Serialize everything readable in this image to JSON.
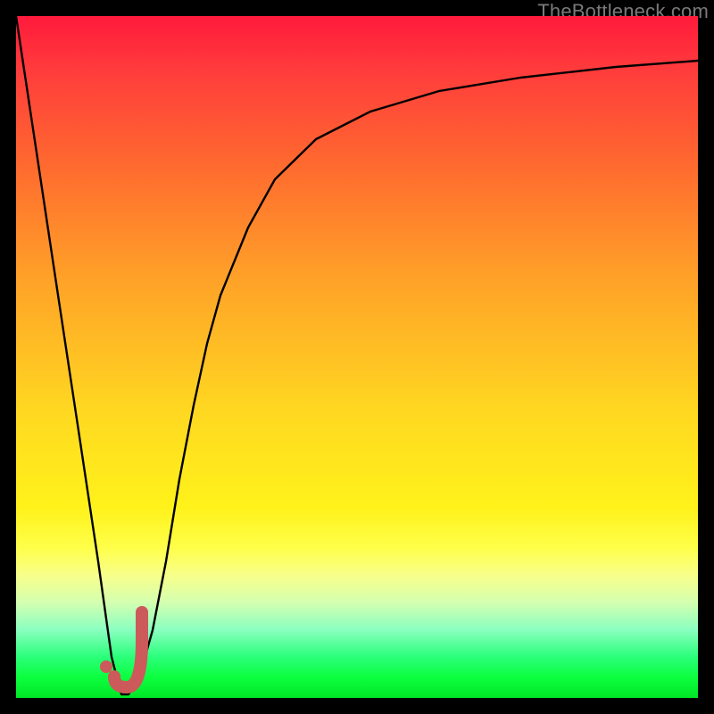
{
  "watermark": "TheBottleneck.com",
  "colors": {
    "frame": "#000000",
    "curve": "#000000",
    "marker_stroke": "#cc5a5a",
    "marker_fill": "#cc5a5a"
  },
  "chart_data": {
    "type": "line",
    "title": "",
    "xlabel": "",
    "ylabel": "",
    "xlim": [
      0,
      100
    ],
    "ylim": [
      0,
      100
    ],
    "grid": false,
    "series": [
      {
        "name": "bottleneck-curve",
        "x": [
          0,
          3,
          6,
          9,
          12,
          14,
          15,
          15.5,
          16.5,
          18,
          20,
          22,
          24,
          26,
          28,
          30,
          34,
          38,
          44,
          52,
          62,
          74,
          88,
          100
        ],
        "y": [
          100,
          80,
          60,
          40,
          20,
          6,
          2,
          0.5,
          0.5,
          3,
          10,
          20,
          32,
          43,
          52,
          59,
          69,
          76,
          82,
          86,
          89,
          91,
          92.5,
          93.5
        ]
      }
    ],
    "annotations": [
      {
        "name": "hook-marker",
        "shape": "J",
        "x_range": [
          14.5,
          18.5
        ],
        "y_range": [
          0,
          12
        ]
      },
      {
        "name": "dot-marker",
        "shape": "dot",
        "x": 13.5,
        "y": 4
      }
    ]
  }
}
